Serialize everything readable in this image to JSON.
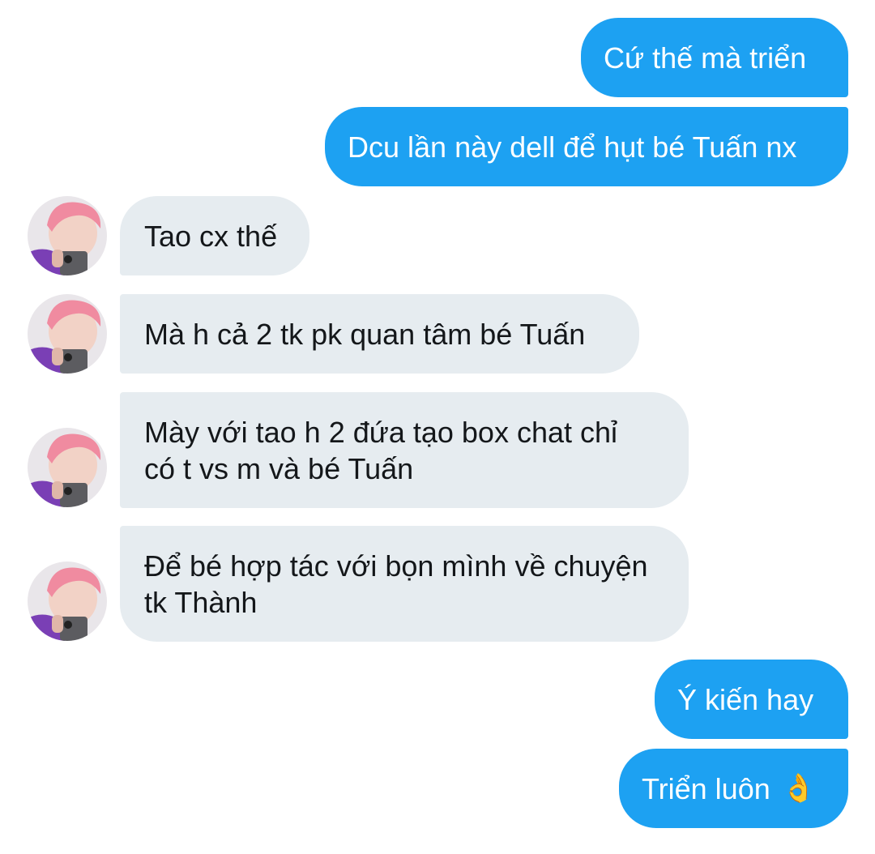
{
  "conversation": {
    "messages": [
      {
        "id": "m1",
        "direction": "outgoing",
        "text": "Cứ thế mà triển"
      },
      {
        "id": "m2",
        "direction": "outgoing",
        "text": "Dcu lần này dell để hụt bé Tuấn nx"
      },
      {
        "id": "m3",
        "direction": "incoming",
        "text": "Tao cx thế"
      },
      {
        "id": "m4",
        "direction": "incoming",
        "text": "Mà h cả 2 tk pk quan tâm bé Tuấn"
      },
      {
        "id": "m5",
        "direction": "incoming",
        "text": "Mày với tao h 2 đứa tạo box chat chỉ\ncó t vs m và bé Tuấn"
      },
      {
        "id": "m6",
        "direction": "incoming",
        "text": "Để bé hợp tác với bọn mình về chuyện\ntk Thành"
      },
      {
        "id": "m7",
        "direction": "outgoing",
        "text": "Ý kiến hay"
      },
      {
        "id": "m8",
        "direction": "outgoing",
        "text": "Triển luôn",
        "emoji": "👌",
        "emoji_name": "ok-hand-emoji"
      }
    ]
  },
  "colors": {
    "outgoing_bubble": "#1da1f2",
    "incoming_bubble": "#e6ecf0",
    "outgoing_text": "#ffffff",
    "incoming_text": "#14171a",
    "avatar_hair": "#f08ba0",
    "avatar_shirt": "#7a3fb5"
  }
}
